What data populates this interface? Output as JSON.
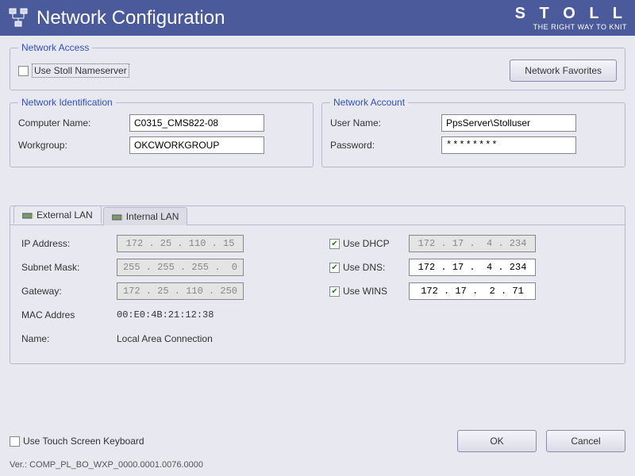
{
  "titlebar": {
    "title": "Network Configuration",
    "brand": "S T O L L",
    "tagline": "THE RIGHT WAY TO KNIT"
  },
  "access": {
    "legend": "Network Access",
    "use_stoll_nameserver": "Use Stoll Nameserver",
    "favorites_btn": "Network Favorites"
  },
  "identification": {
    "legend": "Network Identification",
    "computer_name_label": "Computer Name:",
    "computer_name": "C0315_CMS822-08",
    "workgroup_label": "Workgroup:",
    "workgroup": "OKCWORKGROUP"
  },
  "account": {
    "legend": "Network Account",
    "user_label": "User Name:",
    "user": "PpsServer\\Stolluser",
    "password_label": "Password:",
    "password": "********"
  },
  "tabs": {
    "external": "External LAN",
    "internal": "Internal LAN"
  },
  "lan": {
    "ip_label": "IP Address:",
    "ip": "172 . 25 . 110 . 15",
    "subnet_label": "Subnet Mask:",
    "subnet": "255 . 255 . 255 .  0",
    "gateway_label": "Gateway:",
    "gateway": "172 . 25 . 110 . 250",
    "mac_label": "MAC Addres",
    "mac": "00:E0:4B:21:12:38",
    "name_label": "Name:",
    "name": "Local Area Connection",
    "use_dhcp_label": "Use DHCP",
    "dhcp_ip": "172 . 17 .  4 . 234",
    "use_dns_label": "Use DNS:",
    "dns_ip": "172 . 17 .  4 . 234",
    "use_wins_label": "Use WINS",
    "wins_ip": "172 . 17 .  2 . 71"
  },
  "footer": {
    "touch_kb": "Use Touch Screen Keyboard",
    "ok": "OK",
    "cancel": "Cancel",
    "version": "Ver.: COMP_PL_BO_WXP_0000.0001.0076.0000"
  }
}
